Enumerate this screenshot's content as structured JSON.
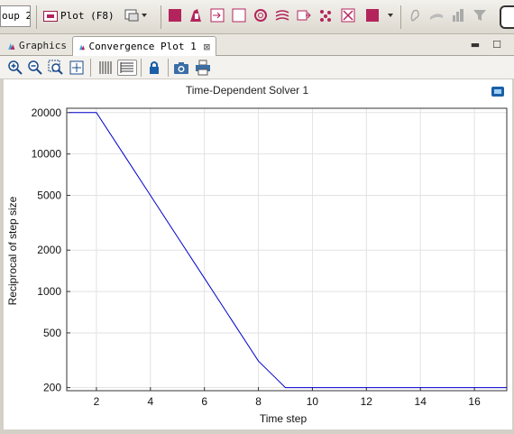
{
  "toolbar": {
    "group_field_text": "oup 2",
    "plot_label": "Plot (F8)",
    "accent": "#b3245c"
  },
  "tabs": [
    {
      "label": "Graphics",
      "icon": "graphics-icon",
      "active": false
    },
    {
      "label": "Convergence Plot 1",
      "icon": "plot-tab-icon",
      "active": true,
      "close_glyph": "⊠"
    }
  ],
  "plot_toolbar": {
    "buttons": [
      "zoom-in-icon",
      "zoom-out-icon",
      "zoom-box-icon",
      "zoom-extents-icon",
      "legend-icon",
      "grid-icon",
      "lock-icon",
      "camera-icon",
      "print-icon"
    ]
  },
  "chart_data": {
    "type": "line",
    "title": "Time-Dependent Solver 1",
    "xlabel": "Time step",
    "ylabel": "Reciprocal of step size",
    "xlim": [
      0.9,
      17.2
    ],
    "ylim": [
      190,
      21500
    ],
    "yscale": "log",
    "grid": true,
    "x_ticks": [
      2,
      4,
      6,
      8,
      10,
      12,
      14,
      16
    ],
    "y_ticks": [
      200,
      500,
      1000,
      2000,
      5000,
      10000,
      20000
    ],
    "line_color": "#0000cc",
    "series": [
      {
        "x": [
          1,
          2,
          3,
          4,
          5,
          6,
          7,
          8,
          8.5,
          9,
          10,
          11,
          12,
          13,
          14,
          15,
          16,
          17.2
        ],
        "y": [
          20000,
          20000,
          10000,
          5000,
          2500,
          1250,
          625,
          312,
          250,
          200,
          200,
          200,
          200,
          200,
          200,
          200,
          200,
          200
        ]
      }
    ]
  }
}
